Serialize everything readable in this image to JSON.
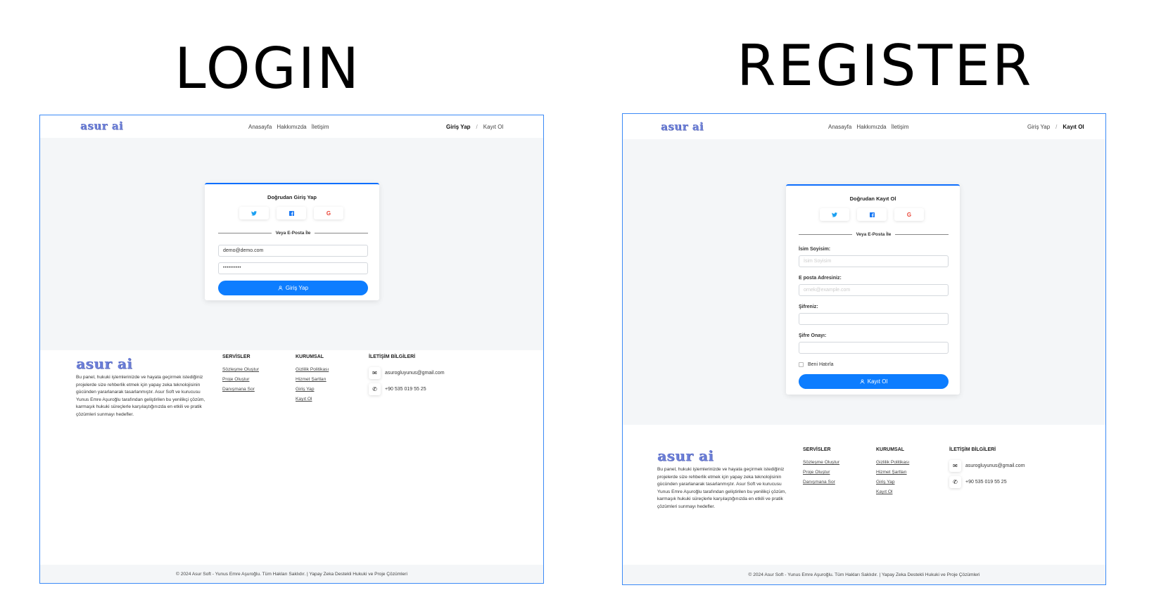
{
  "titles": {
    "login": "LOGIN",
    "register": "REGISTER"
  },
  "nav": {
    "logo": "asur ai",
    "links": [
      "Anasayfa",
      "Hakkımızda",
      "İletişim"
    ],
    "login_link": "Giriş Yap",
    "separator": "/",
    "register_link": "Kayıt Ol"
  },
  "social": {
    "twitter": "twitter-icon",
    "facebook": "facebook-icon",
    "google": "G"
  },
  "login_card": {
    "title": "Doğrudan Giriş Yap",
    "divider": "Veya E-Posta İle",
    "email_value": "demo@demo.com",
    "password_value": "••••••••••",
    "submit": "Giriş Yap"
  },
  "register_card": {
    "title": "Doğrudan Kayıt Ol",
    "divider": "Veya E-Posta İle",
    "name_label": "İsim Soyisim:",
    "name_placeholder": "İsim Soyisim",
    "email_label": "E posta Adresiniz:",
    "email_placeholder": "ornek@example.com",
    "password_label": "Şifreniz:",
    "password_confirm_label": "Şifre Onayı:",
    "remember": "Beni Hatırla",
    "submit": "Kayıt Ol"
  },
  "footer": {
    "logo": "asur ai",
    "description": "Bu panel, hukuki işlemlerinizde ve hayata geçirmek istediğiniz projelerde size rehberlik etmek için yapay zeka teknolojisinin gücünden yararlanarak tasarlanmıştır. Asur Soft ve kurucusu Yunus Emre Aşuroğlu tarafından geliştirilen bu yenilikçi çözüm, karmaşık hukuki süreçlerle karşılaştığınızda en etkili ve pratik çözümleri sunmayı hedefler.",
    "services_title": "SERVİSLER",
    "services": [
      "Sözleşme Oluştur",
      "Proje Oluştur",
      "Danışmana Sor"
    ],
    "corporate_title": "KURUMSAL",
    "corporate": [
      "Gizlilik Politikası",
      "Hizmet Şartları",
      "Giriş Yap",
      "Kayıt Ol"
    ],
    "contact_title": "İLETİŞİM BİLGİLERİ",
    "email": "asurogluyunus@gmail.com",
    "phone": "+90 535 019 55 25",
    "copyright": "© 2024 Asur Soft - Yunus Emre Aşuroğlu. Tüm Hakları Saklıdır. | Yapay Zeka Destekli Hukuki ve Proje Çözümleri"
  }
}
